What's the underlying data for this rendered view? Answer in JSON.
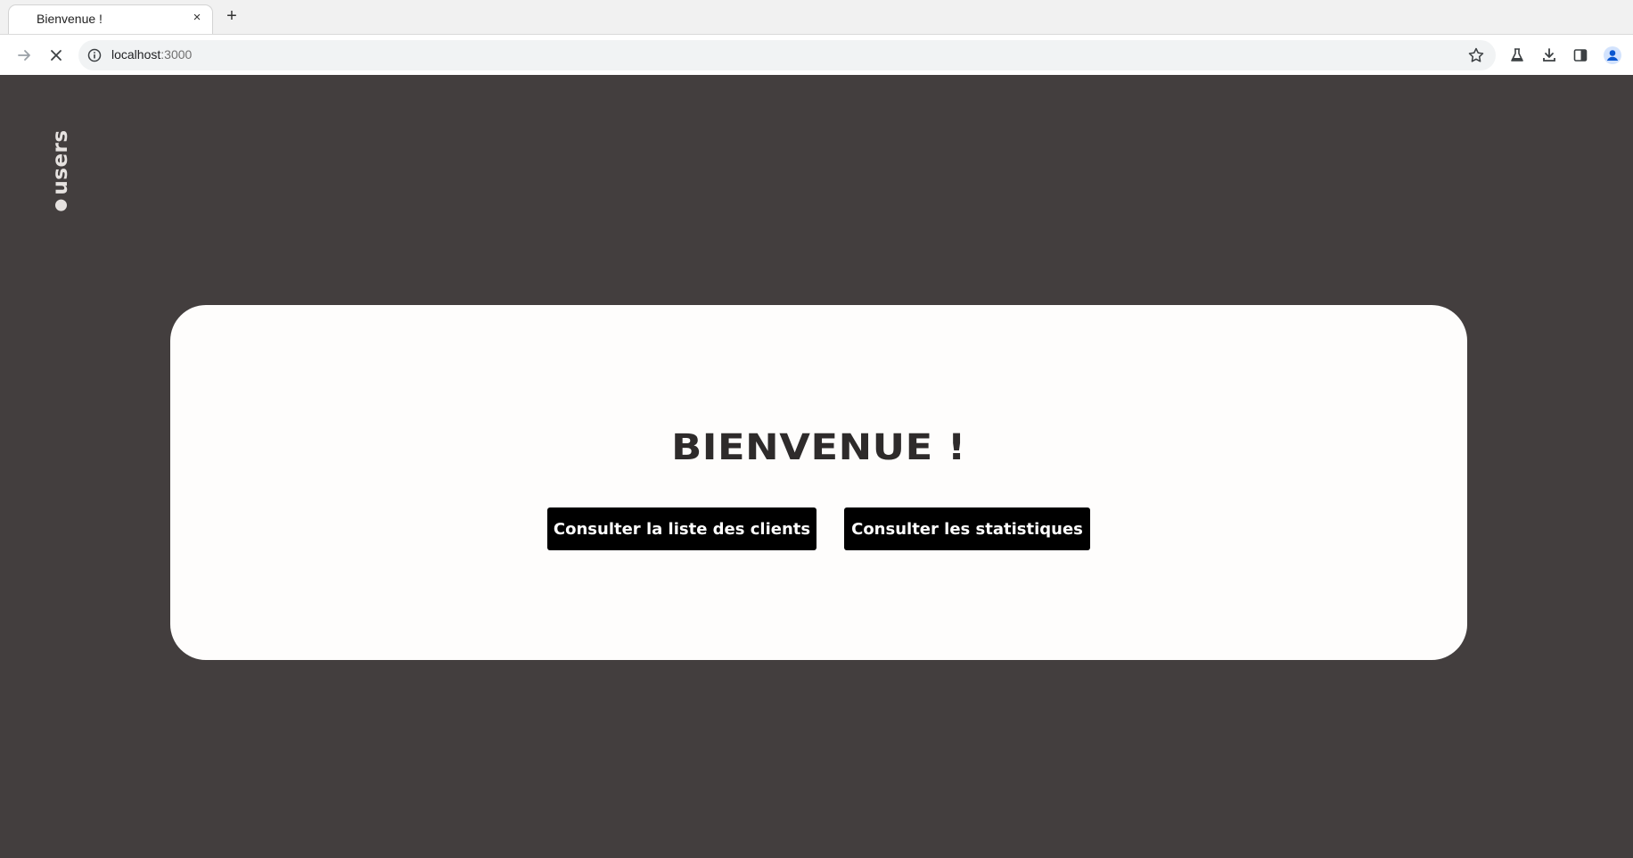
{
  "browser": {
    "tab_title": "Bienvenue !",
    "tab_close": "×",
    "new_tab": "+",
    "url_host": "localhost",
    "url_port": ":3000"
  },
  "sidebar": {
    "logo_text": "users"
  },
  "main": {
    "heading": "BIENVENUE !",
    "buttons": {
      "clients": "Consulter la liste des clients",
      "stats": "Consulter les statistiques"
    }
  },
  "colors": {
    "page_background": "#433e3e",
    "card_background": "#fefdfc",
    "button_background": "#000000",
    "heading_color": "#2e2b2b"
  },
  "icons": [
    "forward-icon",
    "stop-loading-icon",
    "site-info-icon",
    "bookmark-star-icon",
    "labs-flask-icon",
    "download-icon",
    "side-panel-icon",
    "profile-avatar-icon"
  ]
}
